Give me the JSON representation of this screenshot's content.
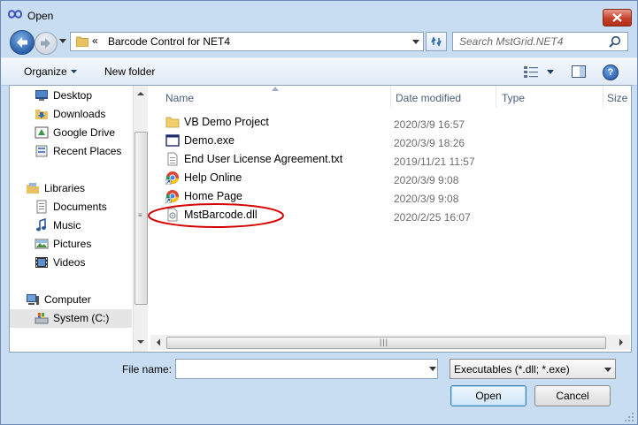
{
  "window": {
    "title": "Open"
  },
  "address": {
    "chevron": "«",
    "path": "Barcode Control for NET4"
  },
  "search": {
    "placeholder": "Search MstGrid.NET4"
  },
  "toolbar": {
    "organize": "Organize",
    "new_folder": "New folder"
  },
  "nav": {
    "favorites": [
      "Desktop",
      "Downloads",
      "Google Drive",
      "Recent Places"
    ],
    "libraries_label": "Libraries",
    "libraries": [
      "Documents",
      "Music",
      "Pictures",
      "Videos"
    ],
    "computer_label": "Computer",
    "drives": [
      "System (C:)"
    ]
  },
  "columns": {
    "name": "Name",
    "date_modified": "Date modified",
    "type": "Type",
    "size": "Size"
  },
  "files": [
    {
      "name": "VB Demo Project",
      "date": "2020/3/9 16:57",
      "icon": "folder-icon"
    },
    {
      "name": "Demo.exe",
      "date": "2020/3/9 18:26",
      "icon": "exe-icon"
    },
    {
      "name": "End User License Agreement.txt",
      "date": "2019/11/21 11:57",
      "icon": "text-file-icon"
    },
    {
      "name": "Help Online",
      "date": "2020/3/9 9:08",
      "icon": "chrome-shortcut-icon"
    },
    {
      "name": "Home Page",
      "date": "2020/3/9 9:08",
      "icon": "chrome-shortcut-icon"
    },
    {
      "name": "MstBarcode.dll",
      "date": "2020/2/25 16:07",
      "icon": "dll-file-icon"
    }
  ],
  "highlight_color": "#d40000",
  "file_name": {
    "label": "File name:",
    "value": ""
  },
  "filter": {
    "selected": "Executables (*.dll; *.exe)"
  },
  "buttons": {
    "open": "Open",
    "cancel": "Cancel"
  }
}
